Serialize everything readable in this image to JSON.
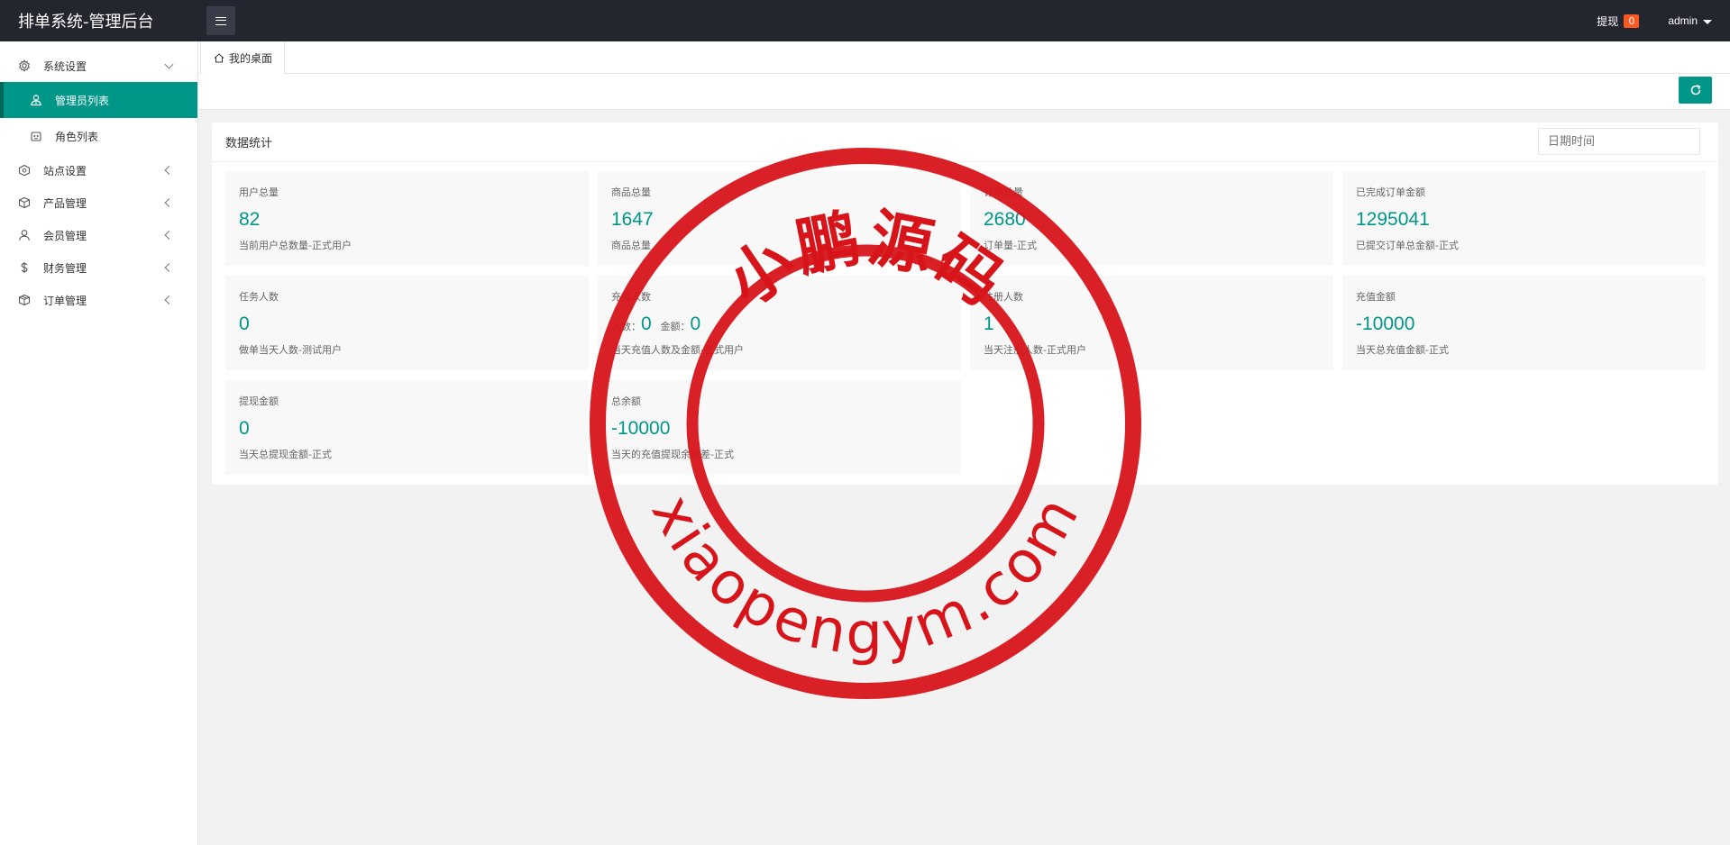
{
  "app": {
    "title": "排单系统-管理后台"
  },
  "header": {
    "withdraw_label": "提现",
    "withdraw_badge": "0",
    "user_name": "admin"
  },
  "sidebar": {
    "items": [
      {
        "label": "系统设置",
        "icon": "gear-icon",
        "expanded": true
      },
      {
        "label": "管理员列表",
        "icon": "user-tie-icon",
        "active": true,
        "sub": true
      },
      {
        "label": "角色列表",
        "icon": "role-icon",
        "sub": true
      },
      {
        "label": "站点设置",
        "icon": "site-icon"
      },
      {
        "label": "产品管理",
        "icon": "box-icon"
      },
      {
        "label": "会员管理",
        "icon": "user-icon"
      },
      {
        "label": "财务管理",
        "icon": "dollar-icon"
      },
      {
        "label": "订单管理",
        "icon": "order-icon"
      }
    ]
  },
  "tabs": {
    "home_label": "我的桌面"
  },
  "stats": {
    "title": "数据统计",
    "date_placeholder": "日期时间",
    "cards": [
      {
        "label": "用户总量",
        "value": "82",
        "desc": "当前用户总数量-正式用户"
      },
      {
        "label": "商品总量",
        "value": "1647",
        "desc": "商品总量"
      },
      {
        "label": "订单总量",
        "value": "2680",
        "desc": "订单量-正式"
      },
      {
        "label": "已完成订单金额",
        "value": "1295041",
        "desc": "已提交订单总金额-正式"
      },
      {
        "label": "任务人数",
        "value": "0",
        "desc": "做单当天人数-测试用户"
      },
      {
        "label": "充值人数",
        "count_label": "人数：",
        "count_value": "0",
        "amount_label": "金额：",
        "amount_value": "0",
        "desc": "当天充值人数及金额-正式用户"
      },
      {
        "label": "注册人数",
        "value": "1",
        "desc": "当天注册人数-正式用户"
      },
      {
        "label": "充值金额",
        "value": "-10000",
        "desc": "当天总充值金额-正式"
      },
      {
        "label": "提现金额",
        "value": "0",
        "desc": "当天总提现金额-正式"
      },
      {
        "label": "总余额",
        "value": "-10000",
        "desc": "当天的充值提现余额差-正式"
      }
    ]
  },
  "stamp": {
    "top_text": "小鹏源码",
    "bottom_text": "xiaopengym.com",
    "color": "#d7141a"
  },
  "colors": {
    "accent": "#009688",
    "header_bg": "#23262e",
    "badge": "#ff5722"
  }
}
